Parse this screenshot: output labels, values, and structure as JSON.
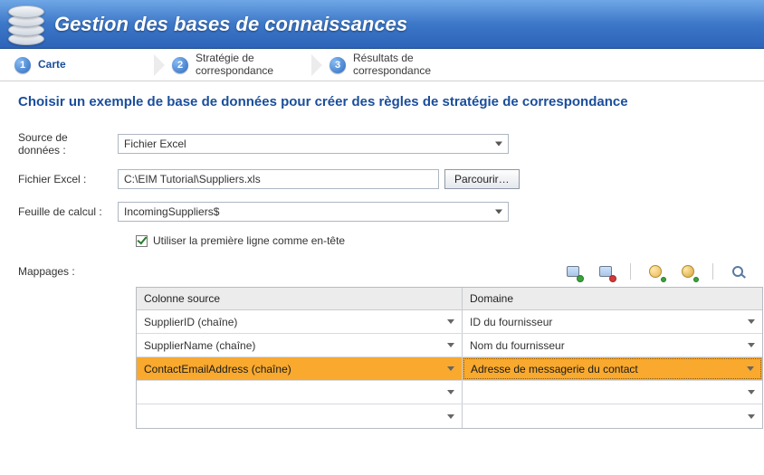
{
  "header": {
    "title": "Gestion des bases de connaissances"
  },
  "wizard": {
    "steps": [
      {
        "num": "1",
        "label": "Carte"
      },
      {
        "num": "2",
        "label": "Stratégie de\ncorrespondance"
      },
      {
        "num": "3",
        "label": "Résultats de\ncorrespondance"
      }
    ]
  },
  "subheading": "Choisir un exemple de base de données pour créer des règles de stratégie de correspondance",
  "form": {
    "dataSourceLabel": "Source de données :",
    "dataSourceValue": "Fichier Excel",
    "excelFileLabel": "Fichier Excel :",
    "excelFileValue": "C:\\EIM Tutorial\\Suppliers.xls",
    "browseButton": "Parcourir…",
    "worksheetLabel": "Feuille de calcul :",
    "worksheetValue": "IncomingSuppliers$",
    "headerCheckboxLabel": "Utiliser la première ligne comme en-tête",
    "headerCheckboxChecked": true
  },
  "mappings": {
    "label": "Mappages :",
    "headers": {
      "source": "Colonne source",
      "domain": "Domaine"
    },
    "rows": [
      {
        "source": "SupplierID (chaîne)",
        "domain": "ID du fournisseur",
        "active": false
      },
      {
        "source": "SupplierName (chaîne)",
        "domain": "Nom du fournisseur",
        "active": false
      },
      {
        "source": "ContactEmailAddress (chaîne)",
        "domain": "Adresse de messagerie du contact",
        "active": true
      },
      {
        "source": "",
        "domain": "",
        "active": false
      },
      {
        "source": "",
        "domain": "",
        "active": false
      }
    ]
  },
  "toolbarIcons": {
    "addMapping": "add-mapping-icon",
    "removeMapping": "remove-mapping-icon",
    "createDomain": "create-domain-icon",
    "createCompositeDomain": "create-composite-domain-icon",
    "preview": "preview-icon"
  }
}
